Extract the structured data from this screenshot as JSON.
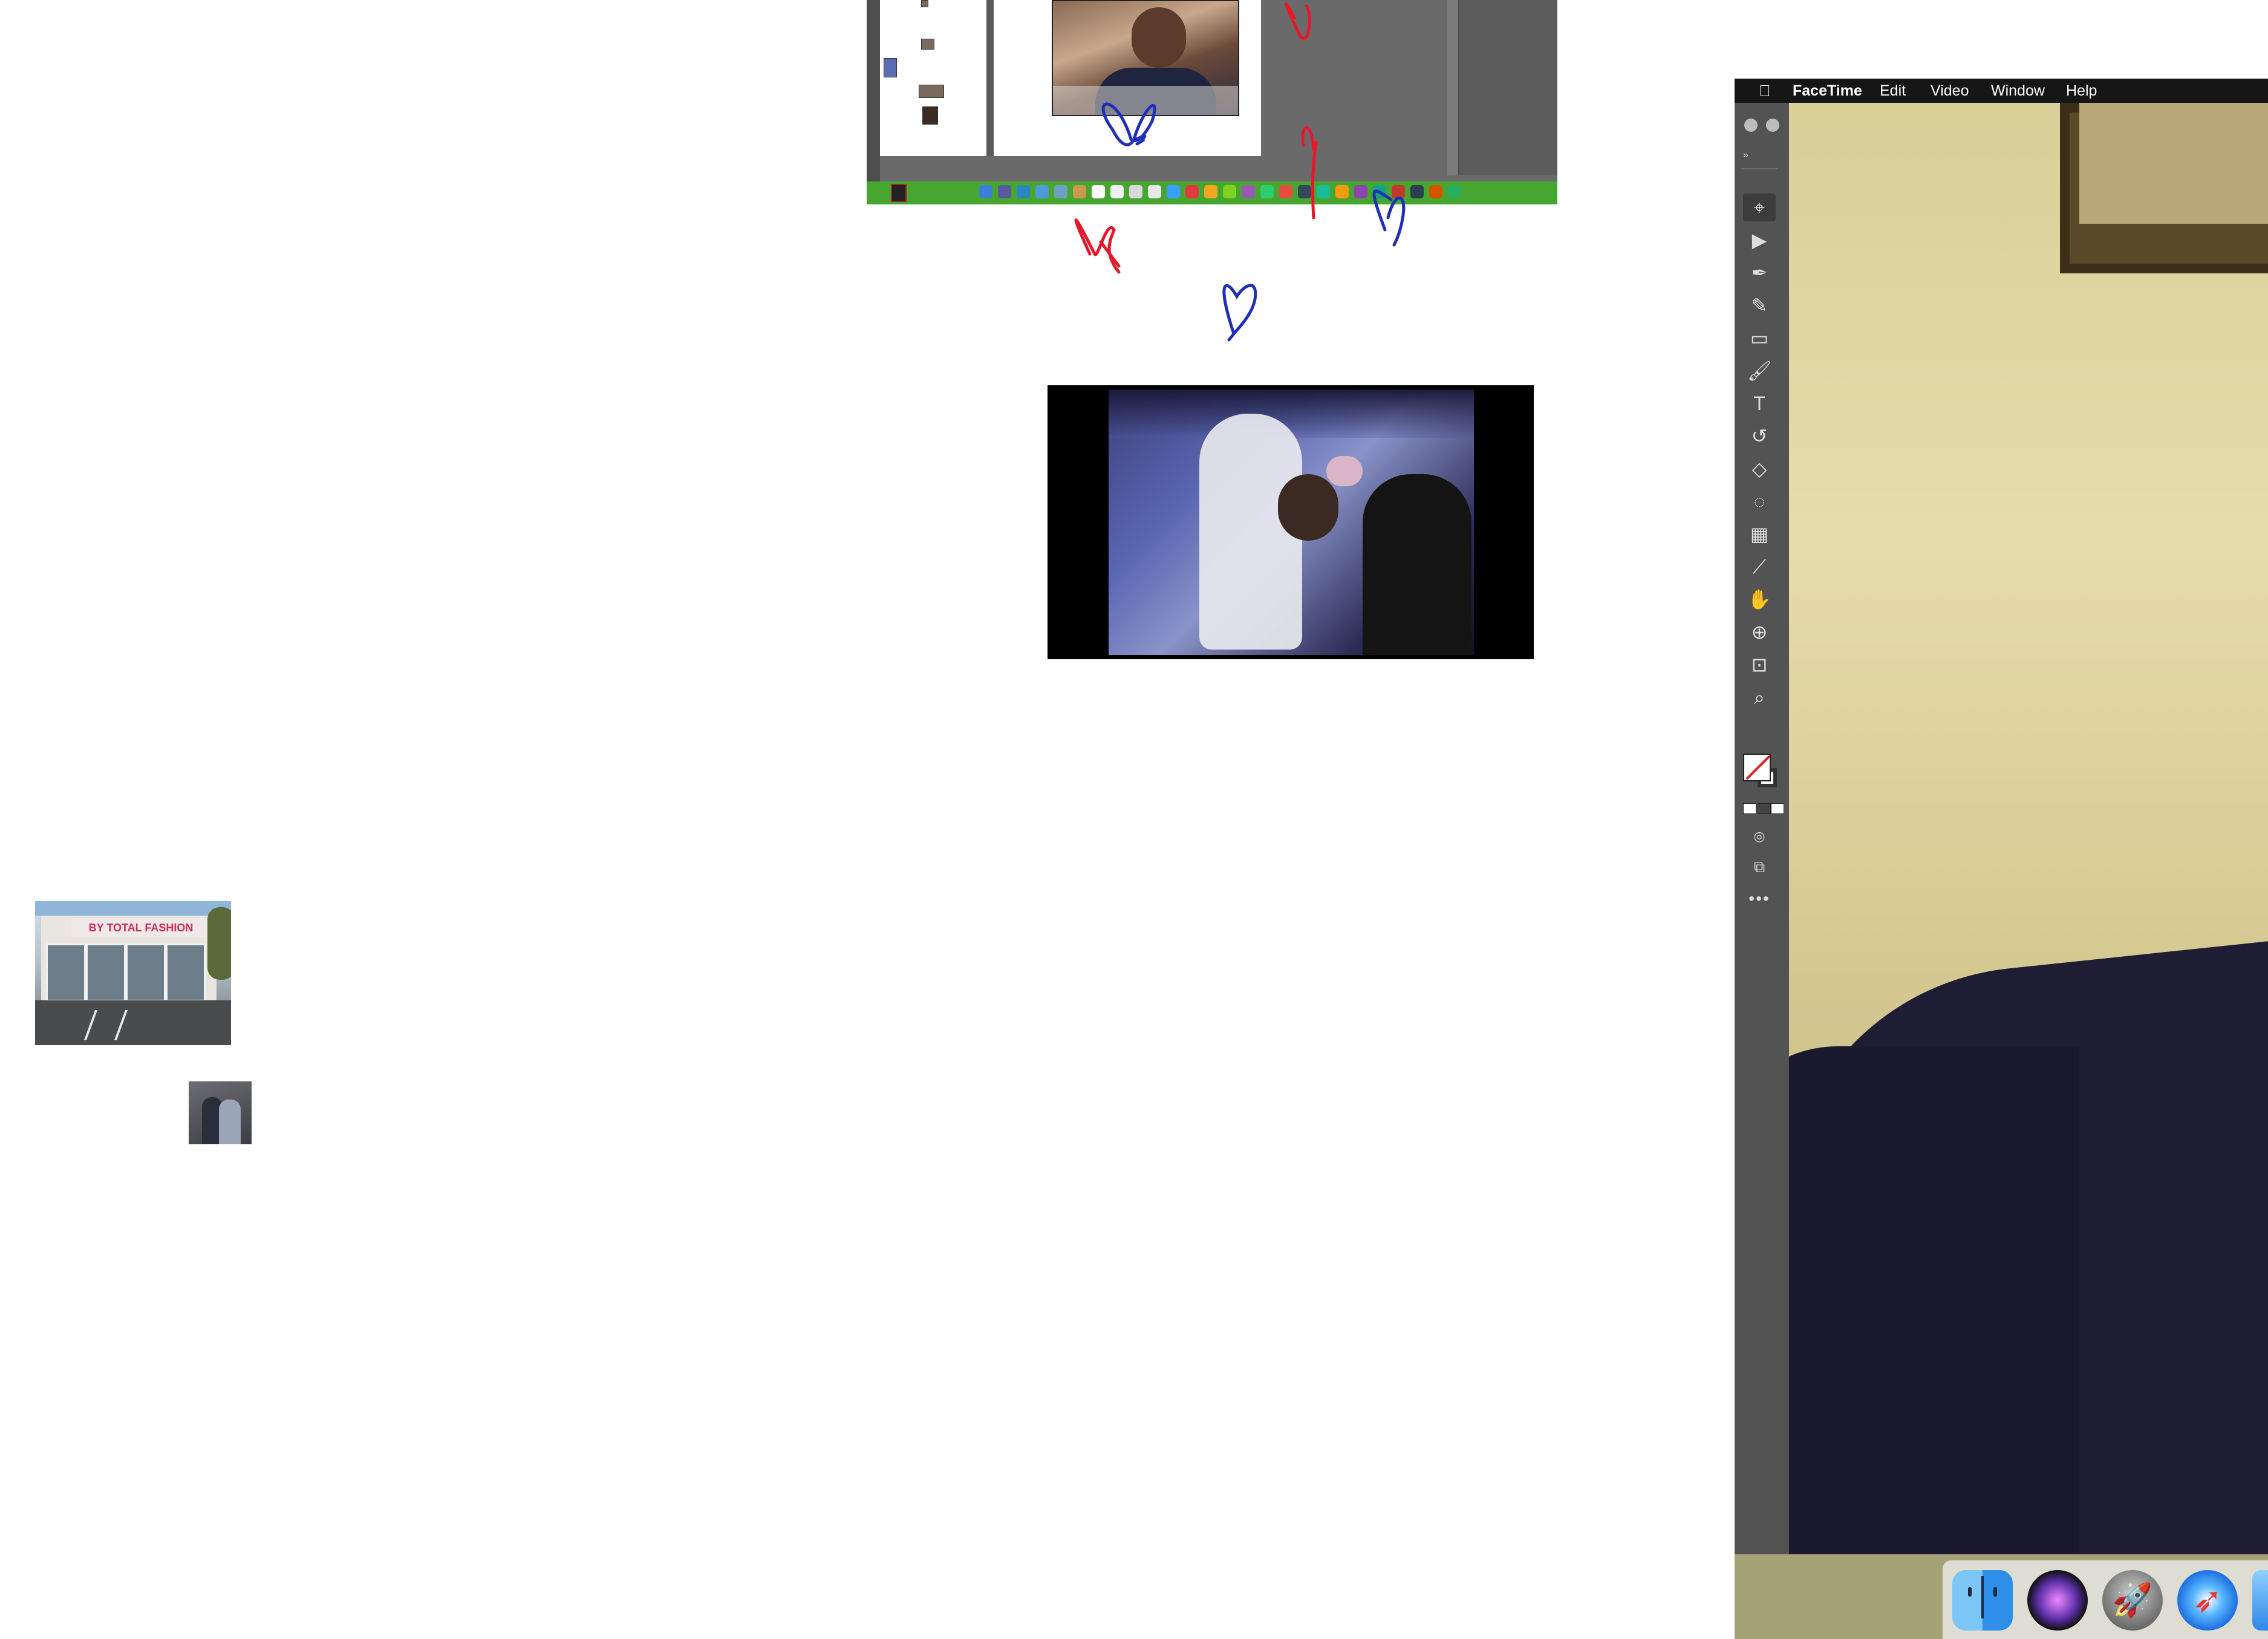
{
  "menubar": {
    "apple_icon": "apple-logo-icon",
    "app_name": "FaceTime",
    "items": [
      "Edit",
      "Video",
      "Window",
      "Help"
    ],
    "background": "#161616"
  },
  "storefront_sign": "BY TOTAL FASHION",
  "tools_panel": {
    "background": "#535353",
    "tools": [
      {
        "name": "selection-tool-icon",
        "glyph": "⌖"
      },
      {
        "name": "direct-selection-tool-icon",
        "glyph": "▶"
      },
      {
        "name": "pen-tool-icon",
        "glyph": "✒"
      },
      {
        "name": "curvature-tool-icon",
        "glyph": "✎"
      },
      {
        "name": "rectangle-tool-icon",
        "glyph": "▭"
      },
      {
        "name": "paintbrush-tool-icon",
        "glyph": "🖌"
      },
      {
        "name": "type-tool-icon",
        "glyph": "T"
      },
      {
        "name": "rotate-tool-icon",
        "glyph": "↺"
      },
      {
        "name": "eraser-tool-icon",
        "glyph": "◇"
      },
      {
        "name": "lasso-tool-icon",
        "glyph": "◌"
      },
      {
        "name": "gradient-tool-icon",
        "glyph": "▦"
      },
      {
        "name": "eyedropper-tool-icon",
        "glyph": "⟋"
      },
      {
        "name": "puppet-warp-tool-icon",
        "glyph": "✋"
      },
      {
        "name": "shape-builder-tool-icon",
        "glyph": "⊕"
      },
      {
        "name": "artboard-tool-icon",
        "glyph": "⊡"
      },
      {
        "name": "zoom-tool-icon",
        "glyph": "⌕"
      }
    ],
    "more_label": "•••"
  },
  "dock": {
    "icons": [
      "finder-icon",
      "siri-icon",
      "launchpad-icon",
      "safari-icon",
      "mail-icon"
    ]
  },
  "colors": {
    "desktop_background": "#ffffff",
    "nested_dock_green": "#46a630",
    "heart_red": "#e5182b",
    "heart_blue": "#1f2fb8"
  }
}
